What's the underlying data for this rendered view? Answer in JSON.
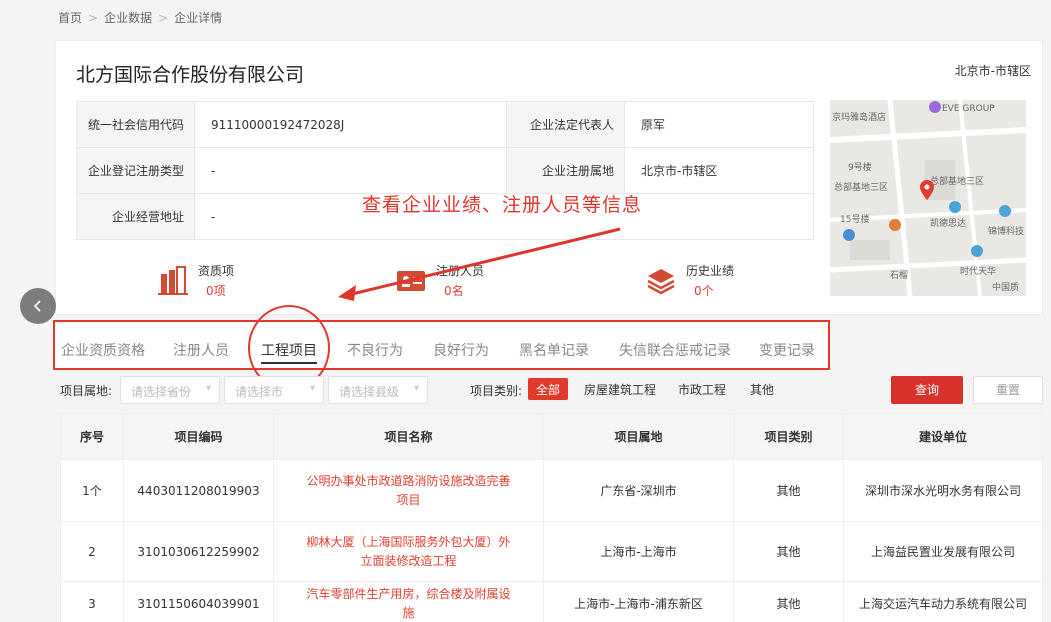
{
  "breadcrumb": [
    "首页",
    "企业数据",
    "企业详情"
  ],
  "company": {
    "name": "北方国际合作股份有限公司",
    "location": "北京市-市辖区",
    "rows": [
      {
        "k1": "统一社会信用代码",
        "v1": "91110000192472028J",
        "k2": "企业法定代表人",
        "v2": "原军"
      },
      {
        "k1": "企业登记注册类型",
        "v1": "-",
        "k2": "企业注册属地",
        "v2": "北京市-市辖区"
      },
      {
        "k1": "企业经营地址",
        "v1": "-"
      }
    ]
  },
  "map": {
    "labels": [
      "EVE GROUP",
      "京玛雅岛酒店",
      "9号楼",
      "总部基地三区",
      "总部基地三区",
      "15号楼",
      "凯德思达",
      "锦博科技",
      "时代天华",
      "中国质",
      "石榴"
    ]
  },
  "stats": [
    {
      "title": "资质项",
      "value": "0项",
      "icon": "building-icon"
    },
    {
      "title": "注册人员",
      "value": "0名",
      "icon": "id-card-icon"
    },
    {
      "title": "历史业绩",
      "value": "0个",
      "icon": "layers-icon"
    }
  ],
  "annotation": "查看企业业绩、注册人员等信息",
  "tabs": [
    "企业资质资格",
    "注册人员",
    "工程项目",
    "不良行为",
    "良好行为",
    "黑名单记录",
    "失信联合惩戒记录",
    "变更记录"
  ],
  "active_tab": "工程项目",
  "filter": {
    "label": "项目属地:",
    "selects": [
      "请选择省份",
      "请选择市",
      "请选择县级"
    ],
    "category_label": "项目类别:",
    "categories": [
      "全部",
      "房屋建筑工程",
      "市政工程",
      "其他"
    ],
    "query": "查询",
    "reset": "重置"
  },
  "table": {
    "headers": [
      "序号",
      "项目编码",
      "项目名称",
      "项目属地",
      "项目类别",
      "建设单位"
    ],
    "rows": [
      {
        "no": "1个",
        "code": "4403011208019903",
        "name": "公明办事处市政道路消防设施改造完善项目",
        "loc": "广东省-深圳市",
        "cat": "其他",
        "owner": "深圳市深水光明水务有限公司"
      },
      {
        "no": "2",
        "code": "3101030612259902",
        "name": "柳林大厦（上海国际服务外包大厦）外立面装修改造工程",
        "loc": "上海市-上海市",
        "cat": "其他",
        "owner": "上海益民置业发展有限公司"
      },
      {
        "no": "3",
        "code": "3101150604039901",
        "name": "汽车零部件生产用房，综合楼及附属设施",
        "loc": "上海市-上海市-浦东新区",
        "cat": "其他",
        "owner": "上海交运汽车动力系统有限公司"
      }
    ]
  },
  "colors": {
    "accent": "#e03a2c",
    "link_red": "#e0402f"
  }
}
